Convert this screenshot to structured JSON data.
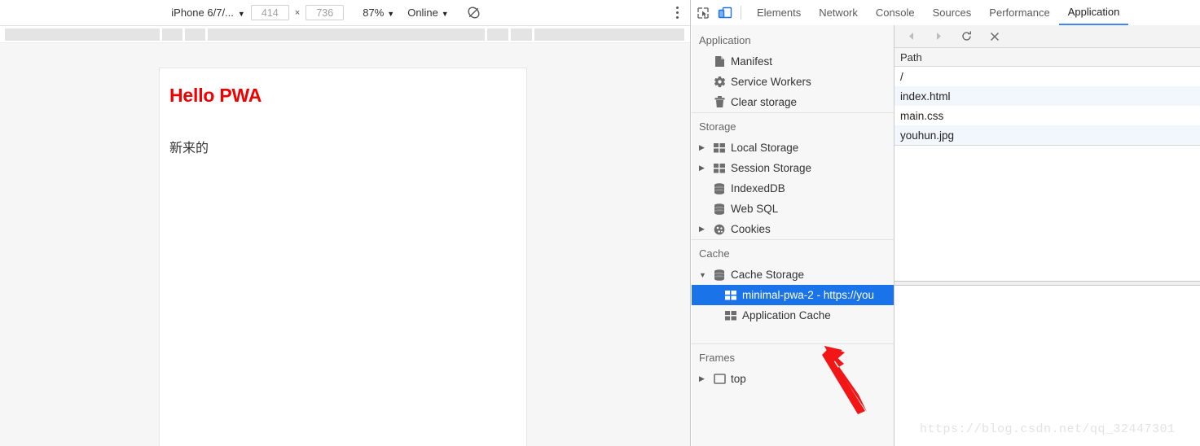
{
  "device_toolbar": {
    "device_name": "iPhone 6/7/...",
    "width_value": "414",
    "height_value": "736",
    "times_symbol": "×",
    "zoom": "87%",
    "network": "Online",
    "caret": "▼",
    "rotate_icon": "rotate-icon",
    "more_icon": "more-options-icon"
  },
  "page": {
    "heading": "Hello PWA",
    "heading_color": "#f00000",
    "paragraph": "新来的"
  },
  "devtools": {
    "icons": {
      "inspect": "inspect-element-icon",
      "device": "toggle-device-toolbar-icon"
    },
    "tabs": [
      {
        "label": "Elements",
        "active": false
      },
      {
        "label": "Network",
        "active": false
      },
      {
        "label": "Console",
        "active": false
      },
      {
        "label": "Sources",
        "active": false
      },
      {
        "label": "Performance",
        "active": false
      },
      {
        "label": "Application",
        "active": true
      }
    ],
    "active_tab_color": "#4285f4"
  },
  "sidebar": {
    "sections": [
      {
        "title": "Application",
        "items": [
          {
            "label": "Manifest",
            "icon": "document-icon",
            "expandable": false,
            "expanded": false,
            "selected": false
          },
          {
            "label": "Service Workers",
            "icon": "gear-icon",
            "expandable": false,
            "expanded": false,
            "selected": false
          },
          {
            "label": "Clear storage",
            "icon": "trash-icon",
            "expandable": false,
            "expanded": false,
            "selected": false
          }
        ]
      },
      {
        "title": "Storage",
        "items": [
          {
            "label": "Local Storage",
            "icon": "table-icon",
            "expandable": true,
            "expanded": false,
            "selected": false
          },
          {
            "label": "Session Storage",
            "icon": "table-icon",
            "expandable": true,
            "expanded": false,
            "selected": false
          },
          {
            "label": "IndexedDB",
            "icon": "database-icon",
            "expandable": false,
            "expanded": false,
            "selected": false
          },
          {
            "label": "Web SQL",
            "icon": "database-icon",
            "expandable": false,
            "expanded": false,
            "selected": false
          },
          {
            "label": "Cookies",
            "icon": "cookie-icon",
            "expandable": true,
            "expanded": false,
            "selected": false
          }
        ]
      },
      {
        "title": "Cache",
        "items": [
          {
            "label": "Cache Storage",
            "icon": "database-icon",
            "expandable": true,
            "expanded": true,
            "selected": false
          },
          {
            "label": "minimal-pwa-2 - https://you",
            "icon": "table-icon",
            "expandable": false,
            "expanded": false,
            "selected": true
          },
          {
            "label": "Application Cache",
            "icon": "table-icon",
            "expandable": false,
            "expanded": false,
            "selected": false
          }
        ]
      },
      {
        "title": "Frames",
        "items": [
          {
            "label": "top",
            "icon": "frame-icon",
            "expandable": true,
            "expanded": false,
            "selected": false
          }
        ]
      }
    ],
    "selection_color": "#1a73e8"
  },
  "cache_view": {
    "toolbar": {
      "back": "back-arrow-icon",
      "forward": "forward-arrow-icon",
      "refresh": "refresh-icon",
      "delete": "delete-x-icon"
    },
    "columns": [
      "Path"
    ],
    "rows": [
      {
        "path": "/"
      },
      {
        "path": "index.html"
      },
      {
        "path": "main.css"
      },
      {
        "path": "youhun.jpg"
      }
    ]
  },
  "annotation": {
    "arrow": "red-pointer-arrow",
    "arrow_color": "#f21616"
  },
  "watermark": {
    "text": "https://blog.csdn.net/qq_32447301"
  }
}
